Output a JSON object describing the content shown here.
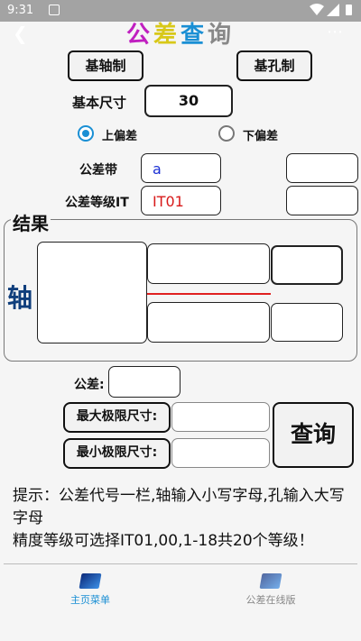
{
  "status_bar": {
    "time": "9:31"
  },
  "header": {
    "title_chars": [
      "公",
      "差",
      "查",
      "询"
    ],
    "back_icon": "chevron-left",
    "menu_icon": "more-dots",
    "menu_glyph": "⋯"
  },
  "system": {
    "btn_shaft": "基轴制",
    "btn_hole": "基孔制"
  },
  "size": {
    "label": "基本尺寸",
    "value": "30"
  },
  "deviation": {
    "upper": "上偏差",
    "lower": "下偏差",
    "selected": "upper"
  },
  "zone": {
    "label": "公差带",
    "value": "a"
  },
  "grade": {
    "label": "公差等级IT",
    "value": "IT01"
  },
  "results": {
    "title": "结果",
    "axis_label": "轴"
  },
  "tolerance": {
    "label": "公差:"
  },
  "limits": {
    "max_label": "最大极限尺寸:",
    "min_label": "最小极限尺寸:"
  },
  "query": {
    "label": "查询"
  },
  "hint": {
    "line1": "提示：公差代号一栏,轴输入小写字母,孔输入大写字母",
    "line2": "精度等级可选择IT01,00,1-18共20个等级！"
  },
  "nav": {
    "home": "主页菜单",
    "online": "公差在线版"
  }
}
